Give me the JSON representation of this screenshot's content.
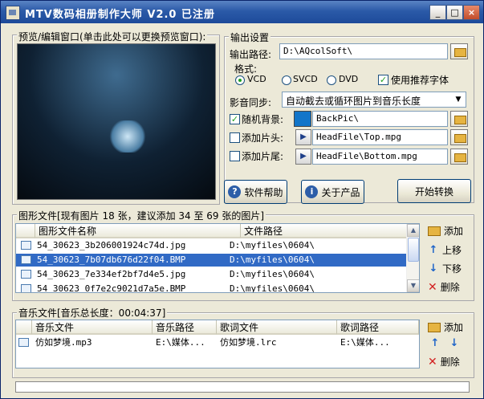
{
  "window": {
    "title": "MTV数码相册制作大师 V2.0   已注册",
    "min": "_",
    "max": "□",
    "close": "×"
  },
  "preview": {
    "label": "预览/编辑窗口(单击此处可以更换预览窗口):"
  },
  "output": {
    "group_label": "输出设置",
    "path_label": "输出路径:",
    "path_value": "D:\\AQcolSoft\\",
    "format_label": "格式:",
    "formats": [
      "VCD",
      "SVCD",
      "DVD"
    ],
    "selected_format": "VCD",
    "recommend_font_label": "使用推荐字体",
    "recommend_font_checked": true
  },
  "sync": {
    "label": "影音同步:",
    "value": "自动截去或循环图片到音乐长度"
  },
  "background": {
    "label": "随机背景:",
    "checked": true,
    "value": "BackPic\\",
    "color": "#1275c9"
  },
  "intro": {
    "label": "添加片头:",
    "checked": false,
    "value": "HeadFile\\Top.mpg"
  },
  "outro": {
    "label": "添加片尾:",
    "checked": false,
    "value": "HeadFile\\Bottom.mpg"
  },
  "buttons": {
    "help": "软件帮助",
    "about": "关于产品",
    "start": "开始转换"
  },
  "images": {
    "section_label": "图形文件[现有图片 18 张，建议添加 34 至 69 张的图片]",
    "columns": [
      "图形文件名称",
      "文件路径"
    ],
    "rows": [
      {
        "name": "54_30623_3b206001924c74d.jpg",
        "path": "D:\\myfiles\\0604\\"
      },
      {
        "name": "54_30623_7b07db676d22f04.BMP",
        "path": "D:\\myfiles\\0604\\"
      },
      {
        "name": "54_30623_7e334ef2bf7d4e5.jpg",
        "path": "D:\\myfiles\\0604\\"
      },
      {
        "name": "54_30623_0f7e2c9021d7a5e.BMP",
        "path": "D:\\myfiles\\0604\\"
      }
    ],
    "selected_row": 1,
    "add": "添加",
    "up": "上移",
    "down": "下移",
    "delete": "删除"
  },
  "music": {
    "section_label": "音乐文件[音乐总长度：00:04:37]",
    "columns": [
      "音乐文件",
      "音乐路径",
      "歌词文件",
      "歌词路径"
    ],
    "rows": [
      {
        "file": "仿如梦境.mp3",
        "path": "E:\\媒体...",
        "lyric": "仿如梦境.lrc",
        "lyric_path": "E:\\媒体..."
      }
    ],
    "add": "添加",
    "delete": "删除"
  }
}
